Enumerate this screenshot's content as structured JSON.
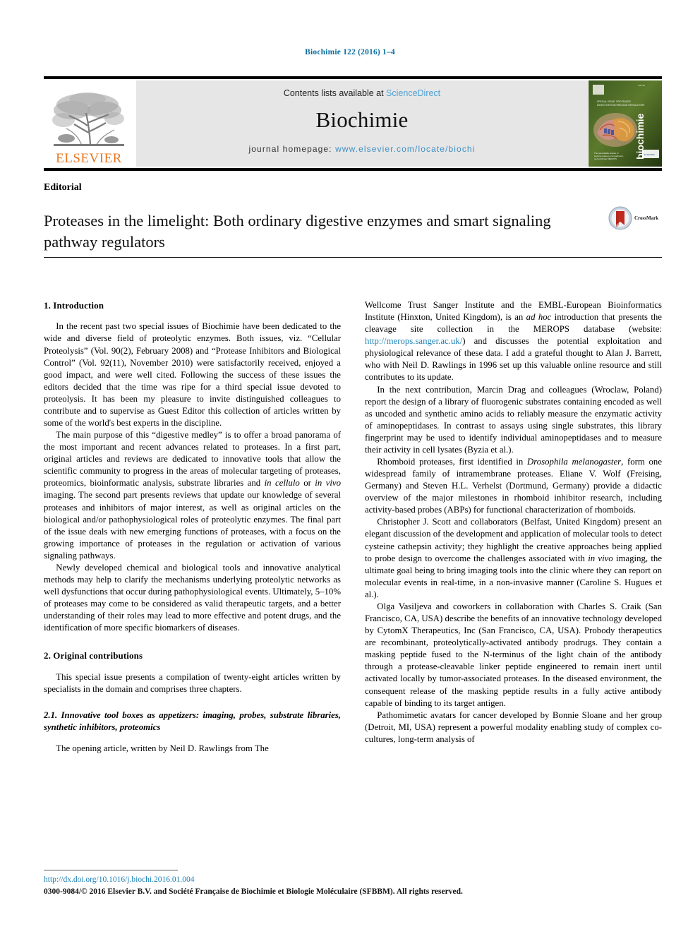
{
  "running_head": "Biochimie 122 (2016) 1–4",
  "masthead": {
    "contents_prefix": "Contents lists available at ",
    "sciencedirect": "ScienceDirect",
    "journal_title": "Biochimie",
    "homepage_prefix": "journal homepage: ",
    "homepage_url": "www.elsevier.com/locate/biochi",
    "publisher_logo_word": "ELSEVIER",
    "cover_journal_word": "biochimie",
    "link_color": "#4EA3D4",
    "band_color": "#e6e6e6",
    "elsevier_orange": "#E87722"
  },
  "article": {
    "kind": "Editorial",
    "title": "Proteases in the limelight: Both ordinary digestive enzymes and smart signaling pathway regulators",
    "crossmark_label": "CrossMark"
  },
  "left_column": {
    "section1_heading": "1.  Introduction",
    "para1": "In the recent past two special issues of Biochimie have been dedicated to the wide and diverse field of proteolytic enzymes. Both issues, viz. “Cellular Proteolysis” (Vol. 90(2), February 2008) and “Protease Inhibitors and Biological Control” (Vol. 92(11), November 2010) were satisfactorily received, enjoyed a good impact, and were well cited. Following the success of these issues the editors decided that the time was ripe for a third special issue devoted to proteolysis. It has been my pleasure to invite distinguished colleagues to contribute and to supervise as Guest Editor this collection of articles written by some of the world's best experts in the discipline.",
    "para2_a": "The main purpose of this “digestive medley” is to offer a broad panorama of the most important and recent advances related to proteases. In a first part, original articles and reviews are dedicated to innovative tools that allow the scientific community to progress in the areas of molecular targeting of proteases, proteomics, bioinformatic analysis, substrate libraries and ",
    "para2_i1": "in cellulo",
    "para2_b": " or ",
    "para2_i2": "in vivo",
    "para2_c": " imaging. The second part presents reviews that update our knowledge of several proteases and inhibitors of major interest, as well as original articles on the biological and/or pathophysiological roles of proteolytic enzymes. The final part of the issue deals with new emerging functions of proteases, with a focus on the growing importance of proteases in the regulation or activation of various signaling pathways.",
    "para3": "Newly developed chemical and biological tools and innovative analytical methods may help to clarify the mechanisms underlying proteolytic networks as well dysfunctions that occur during pathophysiological events. Ultimately, 5–10% of proteases may come to be considered as valid therapeutic targets, and a better understanding of their roles may lead to more effective and potent drugs, and the identification of more specific biomarkers of diseases.",
    "section2_heading": "2.  Original contributions",
    "para4": "This special issue presents a compilation of twenty-eight articles written by specialists in the domain and comprises three chapters.",
    "subsection_heading": "2.1.  Innovative tool boxes as appetizers: imaging, probes, substrate libraries, synthetic inhibitors, proteomics",
    "para5": "The opening article, written by Neil D. Rawlings from The"
  },
  "right_column": {
    "para1_a": "Wellcome Trust Sanger Institute and the EMBL-European Bioinformatics Institute (Hinxton, United Kingdom), is an ",
    "para1_i1": "ad hoc",
    "para1_b": " introduction that presents the cleavage site collection in the MEROPS database (website: ",
    "para1_link": "http://merops.sanger.ac.uk/",
    "para1_c": ") and discusses the potential exploitation and physiological relevance of these data. I add a grateful thought to Alan J. Barrett, who with Neil D. Rawlings in 1996 set up this valuable online resource and still contributes to its update.",
    "para2": "In the next contribution, Marcin Drag and colleagues (Wroclaw, Poland) report the design of a library of fluorogenic substrates containing encoded as well as uncoded and synthetic amino acids to reliably measure the enzymatic activity of aminopeptidases. In contrast to assays using single substrates, this library fingerprint may be used to identify individual aminopeptidases and to measure their activity in cell lysates (Byzia et al.).",
    "para3_a": "Rhomboid proteases, first identified in ",
    "para3_i1": "Drosophila melanogaster",
    "para3_b": ", form one widespread family of intramembrane proteases. Eliane V. Wolf (Freising, Germany) and Steven H.L. Verhelst (Dortmund, Germany) provide a didactic overview of the major milestones in rhomboid inhibitor research, including activity-based probes (ABPs) for functional characterization of rhomboids.",
    "para4_a": "Christopher J. Scott and collaborators (Belfast, United Kingdom) present an elegant discussion of the development and application of molecular tools to detect cysteine cathepsin activity; they highlight the creative approaches being applied to probe design to overcome the challenges associated with ",
    "para4_i1": "in vivo",
    "para4_b": " imaging, the ultimate goal being to bring imaging tools into the clinic where they can report on molecular events in real-time, in a non-invasive manner (Caroline S. Hugues et al.).",
    "para5": "Olga Vasiljeva and coworkers in collaboration with Charles S. Craik (San Francisco, CA, USA) describe the benefits of an innovative technology developed by CytomX Therapeutics, Inc (San Francisco, CA, USA). Probody therapeutics are recombinant, proteolytically-activated antibody prodrugs. They contain a masking peptide fused to the N-terminus of the light chain of the antibody through a protease-cleavable linker peptide engineered to remain inert until activated locally by tumor-associated proteases. In the diseased environment, the consequent release of the masking peptide results in a fully active antibody capable of binding to its target antigen.",
    "para6": "Pathomimetic avatars for cancer developed by Bonnie Sloane and her group (Detroit, MI, USA) represent a powerful modality enabling study of complex co-cultures, long-term analysis of"
  },
  "footer": {
    "doi": "http://dx.doi.org/10.1016/j.biochi.2016.01.004",
    "copyright": "0300-9084/© 2016 Elsevier B.V. and Société Française de Biochimie et Biologie Moléculaire (SFBBM). All rights reserved."
  }
}
